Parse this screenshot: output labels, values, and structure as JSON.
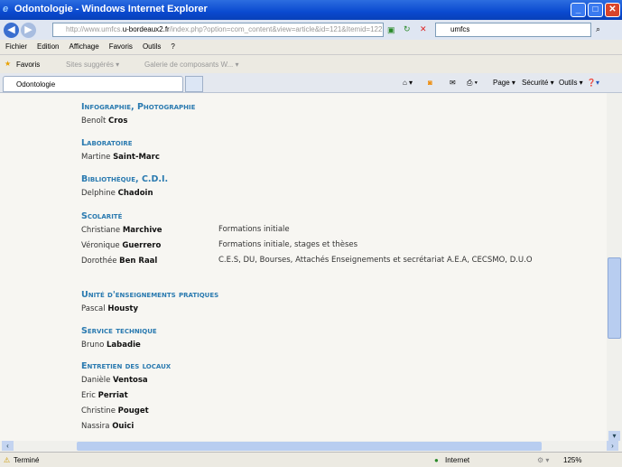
{
  "window": {
    "title": "Odontologie - Windows Internet Explorer"
  },
  "toolbar": {
    "url_prefix": "http://www.umfcs.",
    "url_domain": "u-bordeaux2.fr",
    "url_path": "/index.php?option=com_content&view=article&id=121&Itemid=122",
    "search_value": "umfcs"
  },
  "menu": [
    "Fichier",
    "Edition",
    "Affichage",
    "Favoris",
    "Outils",
    "?"
  ],
  "favorites": {
    "label": "Favoris",
    "items": [
      "Sites suggérés ▾",
      "Galerie de composants W... ▾"
    ]
  },
  "tab": {
    "label": "Odontologie"
  },
  "commands": {
    "page": "Page ▾",
    "securite": "Sécurité ▾",
    "outils": "Outils ▾"
  },
  "sections": [
    {
      "title": "Infographie, Photographie",
      "people": [
        {
          "first": "Benoît",
          "last": "Cros",
          "role": ""
        }
      ]
    },
    {
      "title": "Laboratoire",
      "people": [
        {
          "first": "Martine",
          "last": "Saint-Marc",
          "role": ""
        }
      ]
    },
    {
      "title": "Bibliothèque, C.D.I.",
      "people": [
        {
          "first": "Delphine",
          "last": "Chadoin",
          "role": ""
        }
      ]
    },
    {
      "title": "Scolarité",
      "people": [
        {
          "first": "Christiane",
          "last": "Marchive",
          "role": "Formations initiale"
        },
        {
          "first": "Véronique",
          "last": "Guerrero",
          "role": "Formations initiale, stages et thèses"
        },
        {
          "first": "Dorothée",
          "last": "Ben Raal",
          "role": "C.E.S, DU, Bourses, Attachés Enseignements et secrétariat A.E.A, CECSMO, D.U.O"
        }
      ]
    },
    {
      "title": "Unité d'enseignements pratiques",
      "people": [
        {
          "first": "Pascal",
          "last": "Housty",
          "role": ""
        }
      ]
    },
    {
      "title": "Service technique",
      "people": [
        {
          "first": "Bruno",
          "last": "Labadie",
          "role": ""
        }
      ]
    },
    {
      "title": "Entretien des locaux",
      "people": [
        {
          "first": "Danièle",
          "last": "Ventosa",
          "role": ""
        },
        {
          "first": "Eric",
          "last": "Perriat",
          "role": ""
        },
        {
          "first": "Christine",
          "last": "Pouget",
          "role": ""
        },
        {
          "first": "Nassira",
          "last": "Ouici",
          "role": ""
        }
      ]
    }
  ],
  "status": {
    "text": "Terminé",
    "zone": "Internet",
    "zoom": "125%"
  }
}
